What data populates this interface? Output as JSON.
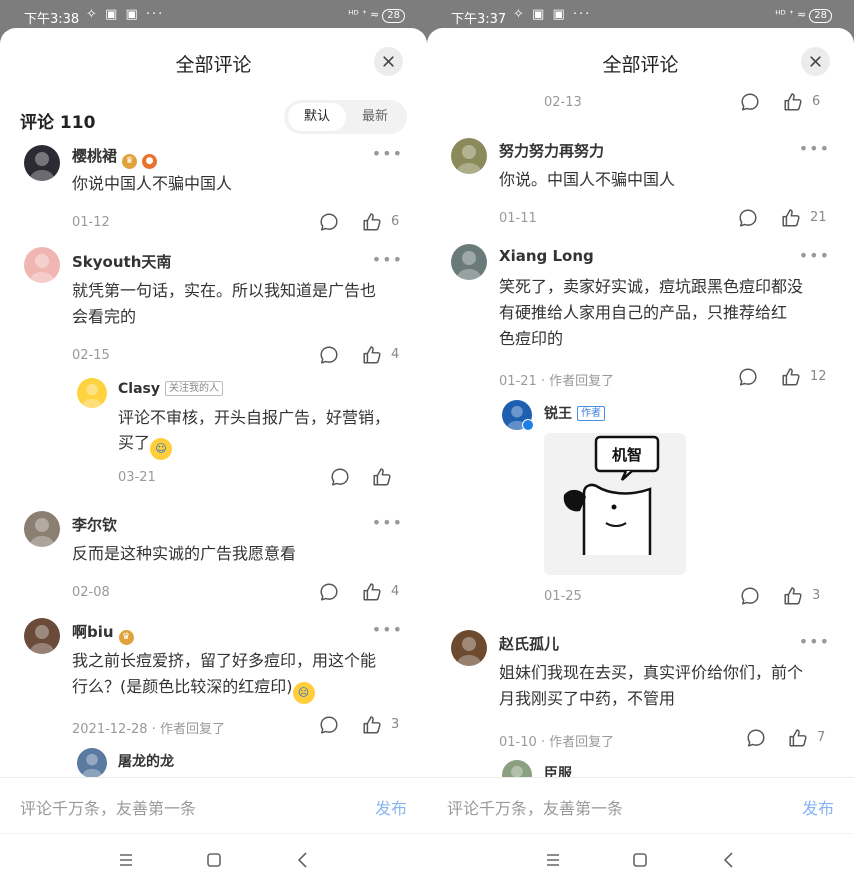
{
  "left": {
    "status": {
      "time": "下午3:38",
      "glyphs": "✧ ▣ ▣ ···",
      "signal": "ᴴᴰ ᐩ ≈",
      "battery": "28"
    },
    "title": "全部评论",
    "count_label": "评论 110",
    "sort": {
      "default": "默认",
      "latest": "最新"
    },
    "comments": [
      {
        "name": "樱桃裙",
        "text": [
          "你说中国人不骗中国人"
        ],
        "date": "01-12",
        "likes": "6"
      },
      {
        "name": "Skyouth天南",
        "text": [
          "就凭第一句话，实在。所以我知道是广告也",
          "会看完的"
        ],
        "date": "02-15",
        "likes": "4"
      },
      {
        "name": "Clasy",
        "tag": "关注我的人",
        "text": [
          "评论不审核，开头自报广告，好营销，",
          "买了"
        ],
        "date": "03-21",
        "likes": ""
      },
      {
        "name": "李尔钦",
        "text": [
          "反而是这种实诚的广告我愿意看"
        ],
        "date": "02-08",
        "likes": "4"
      },
      {
        "name": "啊biu",
        "text": [
          "我之前长痘爱挤，留了好多痘印，用这个能",
          "行么？(是颜色比较深的红痘印)"
        ],
        "date": "2021-12-28 · 作者回复了",
        "likes": "3"
      },
      {
        "name": "屠龙的龙"
      }
    ],
    "input_placeholder": "评论千万条，友善第一条",
    "post_label": "发布"
  },
  "right": {
    "status": {
      "time": "下午3:37",
      "glyphs": "✧ ▣ ▣ ···",
      "signal": "ᴴᴰ ᐩ ≈",
      "battery": "28"
    },
    "title": "全部评论",
    "top": {
      "date": "02-13",
      "likes": "6"
    },
    "comments": [
      {
        "name": "努力努力再努力",
        "text": [
          "你说。中国人不骗中国人"
        ],
        "date": "01-11",
        "likes": "21"
      },
      {
        "name": "Xiang Long",
        "text": [
          "笑死了，卖家好实诚，痘坑跟黑色痘印都没",
          "有硬推给人家用自己的产品，只推荐给红",
          "色痘印的"
        ],
        "date": "01-21 · 作者回复了",
        "likes": "12"
      },
      {
        "name": "锐王",
        "tag": "作者",
        "sticker_text": "机智",
        "date": "01-25",
        "likes": "3"
      },
      {
        "name": "赵氏孤儿",
        "text": [
          "姐妹们我现在去买，真实评价给你们，前个",
          "月我刚买了中药，不管用"
        ],
        "date": "01-10 · 作者回复了",
        "likes": "7"
      },
      {
        "name": "臣服"
      }
    ],
    "input_placeholder": "评论千万条，友善第一条",
    "post_label": "发布"
  },
  "icons": {
    "close": "close-icon",
    "reply": "comment-bubble-icon",
    "like": "thumbs-up-icon",
    "more": "more-dots-icon",
    "menu": "nav-menu-icon",
    "home": "nav-home-icon",
    "back": "nav-back-icon"
  },
  "colors": {
    "accent": "#8ab4f1",
    "verified": "#1e7fe6",
    "badge_gold": "#e0a23a",
    "badge_orange": "#e8732f"
  }
}
